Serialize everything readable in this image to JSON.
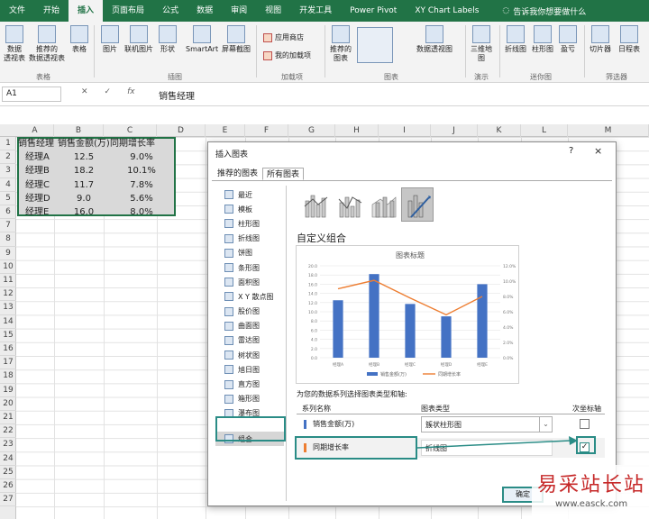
{
  "ribbon": {
    "tabs": [
      "文件",
      "开始",
      "插入",
      "页面布局",
      "公式",
      "数据",
      "审阅",
      "视图",
      "开发工具",
      "Power Pivot",
      "XY Chart Labels"
    ],
    "active_tab": "插入",
    "tell_me": "告诉我你想要做什么",
    "buttons": {
      "pivot_table": "数据\n透视表",
      "recommended_pivot": "推荐的\n数据透视表",
      "table": "表格",
      "pictures": "图片",
      "online_pictures": "联机图片",
      "shapes": "形状",
      "smartart": "SmartArt",
      "screenshot": "屏幕截图",
      "store": "应用商店",
      "my_addins": "我的加载项",
      "recommended_charts": "推荐的\n图表",
      "pivot_chart": "数据透视图",
      "map_3d": "三维地\n图",
      "line_spark": "折线图",
      "column_spark": "柱形图",
      "winloss": "盈亏",
      "slicer": "切片器",
      "timeline": "日程表"
    },
    "groups": {
      "tables": "表格",
      "illustrations": "插图",
      "addins": "加载项",
      "charts": "图表",
      "tours": "演示",
      "sparklines": "迷你图",
      "filters": "筛选器"
    }
  },
  "formula_bar": {
    "name_box": "A1",
    "fx": "fx",
    "content": "销售经理"
  },
  "sheet": {
    "columns": [
      "A",
      "B",
      "C",
      "D",
      "E",
      "F",
      "G",
      "H",
      "I",
      "J",
      "K",
      "L",
      "M"
    ],
    "rows": [
      "1",
      "2",
      "3",
      "4",
      "5",
      "6",
      "7",
      "8",
      "9",
      "10",
      "11",
      "12",
      "13",
      "14",
      "15",
      "16",
      "17",
      "18",
      "19",
      "20",
      "21",
      "22",
      "23",
      "24",
      "25",
      "26",
      "27"
    ],
    "headers": [
      "销售经理",
      "销售金额(万)",
      "同期增长率"
    ],
    "data": [
      [
        "经理A",
        "12.5",
        "9.0%"
      ],
      [
        "经理B",
        "18.2",
        "10.1%"
      ],
      [
        "经理C",
        "11.7",
        "7.8%"
      ],
      [
        "经理D",
        "9.0",
        "5.6%"
      ],
      [
        "经理E",
        "16.0",
        "8.0%"
      ]
    ]
  },
  "dialog": {
    "title": "插入图表",
    "help": "?",
    "close": "×",
    "tabs": [
      "推荐的图表",
      "所有图表"
    ],
    "active_tab": "所有图表",
    "sidebar": [
      "最近",
      "模板",
      "柱形图",
      "折线图",
      "饼图",
      "条形图",
      "面积图",
      "X Y 散点图",
      "股价图",
      "曲面图",
      "雷达图",
      "树状图",
      "旭日图",
      "直方图",
      "箱形图",
      "瀑布图",
      "组合"
    ],
    "sidebar_active": "组合",
    "section_title": "自定义组合",
    "assign_label": "为您的数据系列选择图表类型和轴:",
    "table_headers": [
      "系列名称",
      "图表类型",
      "次坐标轴"
    ],
    "series_rows": [
      {
        "name": "销售金额(万)",
        "type": "簇状柱形图",
        "secondary": false,
        "color": "#4472c4"
      },
      {
        "name": "同期增长率",
        "type": "折线图",
        "secondary": true,
        "color": "#ed7d31"
      }
    ],
    "check_mark": "✓",
    "dropdown_arrow": "⌄",
    "ok_label": "确定"
  },
  "chart_data": {
    "type": "bar",
    "title": "图表标题",
    "categories": [
      "经理A",
      "经理B",
      "经理C",
      "经理D",
      "经理E"
    ],
    "series": [
      {
        "name": "销售金额(万)",
        "type": "bar",
        "axis": "primary",
        "values": [
          12.5,
          18.2,
          11.7,
          9.0,
          16.0
        ]
      },
      {
        "name": "同期增长率",
        "type": "line",
        "axis": "secondary",
        "values": [
          9.0,
          10.1,
          7.8,
          5.6,
          8.0
        ]
      }
    ],
    "ylim": [
      0,
      20
    ],
    "yticks": [
      "0.0",
      "2.0",
      "4.0",
      "6.0",
      "8.0",
      "10.0",
      "12.0",
      "14.0",
      "16.0",
      "18.0",
      "20.0"
    ],
    "y2lim": [
      0,
      12
    ],
    "y2ticks": [
      "0.0%",
      "2.0%",
      "4.0%",
      "6.0%",
      "8.0%",
      "10.0%",
      "12.0%"
    ],
    "legend": "bottom",
    "grid": true,
    "colors": {
      "bar": "#4472c4",
      "line": "#ed7d31"
    }
  },
  "watermark": {
    "big": "易采站长站",
    "small": "www.easck.com"
  }
}
